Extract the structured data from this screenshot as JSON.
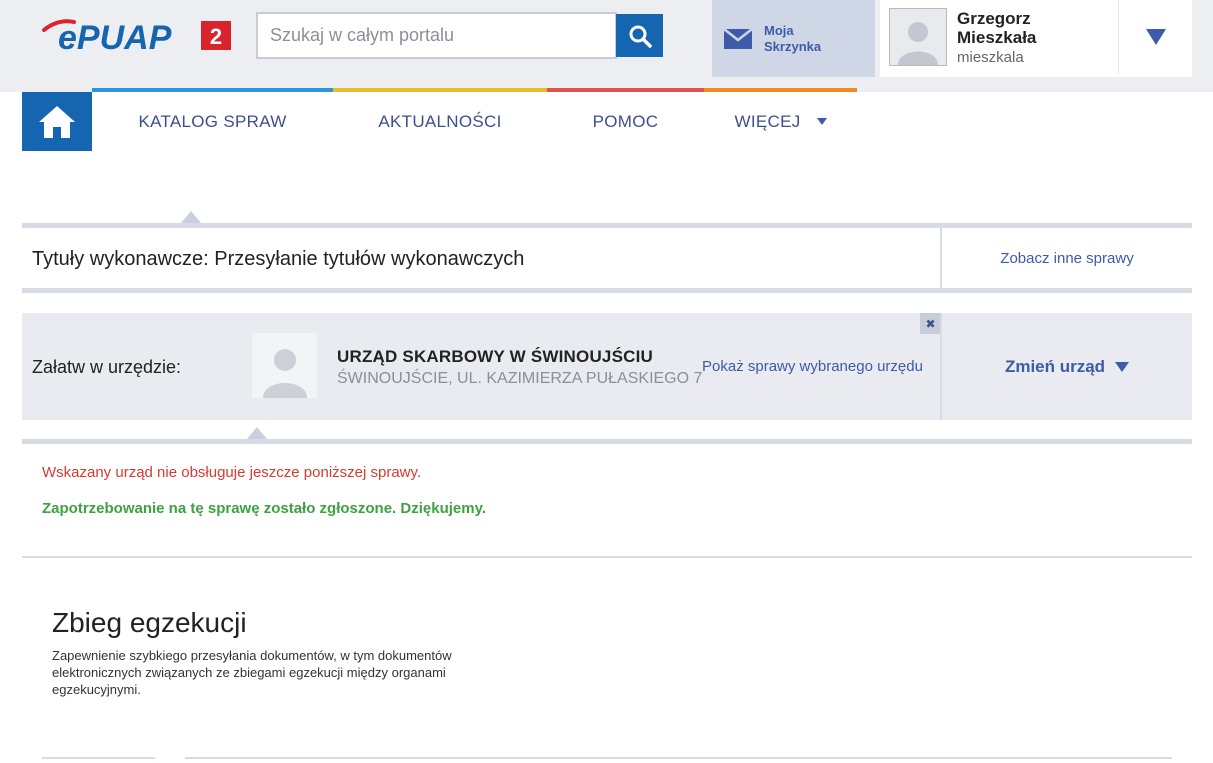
{
  "header": {
    "logo_text": "ePUAP",
    "logo_badge": "2",
    "search": {
      "placeholder": "Szukaj w całym portalu",
      "value": ""
    },
    "mailbox": {
      "line1": "Moja",
      "line2": "Skrzynka"
    },
    "user": {
      "name": "Grzegorz Mieszkała",
      "login": "mieszkala"
    }
  },
  "nav": {
    "items": [
      {
        "label": "KATALOG SPRAW"
      },
      {
        "label": "AKTUALNOŚCI"
      },
      {
        "label": "POMOC"
      },
      {
        "label": "WIĘCEJ"
      }
    ]
  },
  "case": {
    "title": "Tytuły wykonawcze: Przesyłanie tytułów wykonawczych",
    "other_cases_link": "Zobacz inne sprawy"
  },
  "office": {
    "label": "Załatw w urzędzie:",
    "name": "URZĄD SKARBOWY W ŚWINOUJŚCIU",
    "address": "ŚWINOUJŚCIE, UL. KAZIMIERZA PUŁASKIEGO 7",
    "show_cases_link": "Pokaż sprawy wybranego urzędu",
    "change_button": "Zmień urząd",
    "close_symbol": "✖"
  },
  "messages": {
    "error": "Wskazany urząd nie obsługuje jeszcze poniższej sprawy.",
    "success": "Zapotrzebowanie na tę sprawę zostało zgłoszone. Dziękujemy."
  },
  "section": {
    "title": "Zbieg egzekucji",
    "description": "Zapewnienie szybkiego przesyłania dokumentów, w tym dokumentów elektronicznych związanych ze zbiegami egzekucji między organami egzekucyjnymi."
  },
  "colors": {
    "primary": "#1565b0",
    "nav_katalog": "#2a96e0",
    "nav_aktualnosci": "#e8bb2a",
    "nav_pomoc": "#e0504c",
    "nav_wiecej": "#ef8a1e",
    "error": "#d63b2f",
    "success": "#3ea243",
    "link": "#3d5ba9"
  }
}
